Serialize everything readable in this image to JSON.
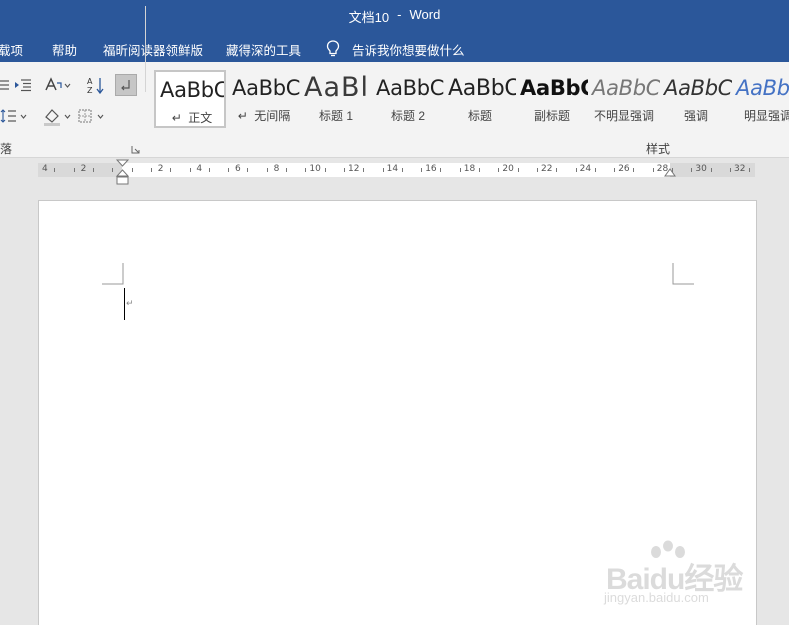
{
  "title_bar": {
    "doc_name": "文档10",
    "separator": "-",
    "app_name": "Word"
  },
  "menu": {
    "tabs": [
      "载项",
      "帮助",
      "福昕阅读器领鲜版",
      "藏得深的工具"
    ],
    "tell_me": "告诉我你想要做什么"
  },
  "ribbon": {
    "paragraph_group_label": "落",
    "styles_group_label": "样式",
    "icons": [
      "bullets-icon",
      "increase-indent-icon",
      "chinese-layout-icon",
      "sort-icon",
      "show-marks-icon",
      "line-spacing-icon",
      "shading-icon",
      "borders-icon"
    ],
    "styles": [
      {
        "preview": "AaBbC",
        "name": "正文",
        "mark": "↵",
        "selected": true
      },
      {
        "preview": "AaBbC",
        "name": "无间隔",
        "mark": "↵",
        "selected": false
      },
      {
        "preview": "AaBl",
        "name": "标题 1",
        "mark": "",
        "selected": false
      },
      {
        "preview": "AaBbC",
        "name": "标题 2",
        "mark": "",
        "selected": false
      },
      {
        "preview": "AaBbC",
        "name": "标题",
        "mark": "",
        "selected": false
      },
      {
        "preview": "AaBbC",
        "name": "副标题",
        "mark": "",
        "selected": false
      },
      {
        "preview": "AaBbC",
        "name": "不明显强调",
        "mark": "",
        "selected": false
      },
      {
        "preview": "AaBbC",
        "name": "强调",
        "mark": "",
        "selected": false
      },
      {
        "preview": "AaBbC",
        "name": "明显强调",
        "mark": "",
        "selected": false
      }
    ]
  },
  "ruler": {
    "left_numbers": [
      "4",
      "2"
    ],
    "right_numbers": [
      "2",
      "4",
      "6",
      "8",
      "10",
      "12",
      "14",
      "16",
      "18",
      "20",
      "22",
      "24",
      "26",
      "28",
      "30",
      "32"
    ]
  },
  "document": {
    "paragraph_mark": "↵"
  },
  "watermark": {
    "brand": "Baidu经验",
    "url": "jingyan.baidu.com"
  },
  "colors": {
    "title_bar": "#2b579a",
    "ribbon": "#f3f3f3",
    "canvas": "#e6e6e6",
    "page": "#ffffff"
  }
}
